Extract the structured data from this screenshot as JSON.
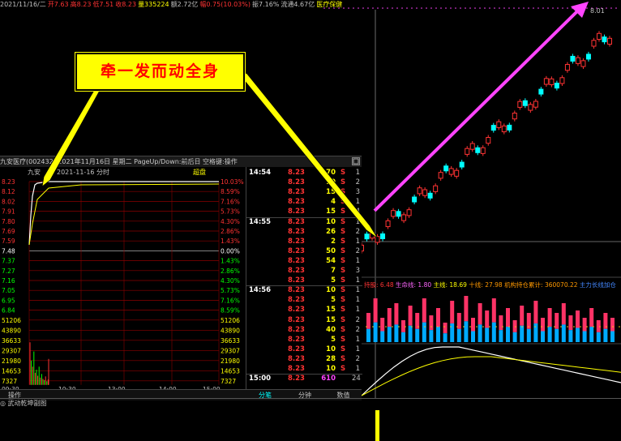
{
  "topbar": [
    {
      "text": "2021/11/16/二",
      "color": "#c0c0c0"
    },
    {
      "text": "开7.63",
      "color": "#ff3333"
    },
    {
      "text": "高8.23",
      "color": "#ff3333"
    },
    {
      "text": "低7.51",
      "color": "#ff3333"
    },
    {
      "text": "收8.23",
      "color": "#ff3333"
    },
    {
      "text": "量335224",
      "color": "#ffff00"
    },
    {
      "text": "额2.72亿",
      "color": "#c0c0c0"
    },
    {
      "text": "幅0.75(10.03%)",
      "color": "#ff3333"
    },
    {
      "text": "振7.16%",
      "color": "#c0c0c0"
    },
    {
      "text": "流通4.67亿",
      "color": "#c0c0c0"
    },
    {
      "text": "医疗保健",
      "color": "#ffff00"
    }
  ],
  "main_chart": {
    "top_price_label": "8.01",
    "indicator_line": [
      {
        "text": "持股: 6.48",
        "color": "#ff3333"
      },
      {
        "text": "生命线: 1.80",
        "color": "#ff66ff"
      },
      {
        "text": "主线: 18.69",
        "color": "#ffff00"
      },
      {
        "text": "十线: 27.98",
        "color": "#ff9900"
      },
      {
        "text": "机构持仓累计: 360070.22",
        "color": "#ff9900"
      },
      {
        "text": "主力长线加仓",
        "color": "#4488ff"
      }
    ],
    "candles": [
      {
        "o": 0.72,
        "c": 0.7,
        "h": 0.735,
        "l": 0.69
      },
      {
        "o": 0.74,
        "c": 0.7,
        "h": 0.75,
        "l": 0.69
      },
      {
        "o": 0.76,
        "c": 0.72,
        "h": 0.77,
        "l": 0.71
      },
      {
        "o": 0.78,
        "c": 0.745,
        "h": 0.79,
        "l": 0.74
      },
      {
        "o": 0.8,
        "c": 0.76,
        "h": 0.81,
        "l": 0.755
      },
      {
        "o": 0.81,
        "c": 0.795,
        "h": 0.82,
        "l": 0.79
      },
      {
        "o": 0.84,
        "c": 0.8,
        "h": 0.85,
        "l": 0.795
      },
      {
        "o": 0.85,
        "c": 0.835,
        "h": 0.86,
        "l": 0.83
      },
      {
        "o": 0.87,
        "c": 0.845,
        "h": 0.875,
        "l": 0.84
      },
      {
        "o": 0.895,
        "c": 0.86,
        "h": 0.9,
        "l": 0.855
      },
      {
        "o": 0.9,
        "c": 0.89,
        "h": 0.91,
        "l": 0.885
      },
      {
        "o": 0.935,
        "c": 0.9,
        "h": 0.94,
        "l": 0.895
      },
      {
        "o": 0.95,
        "c": 0.925,
        "h": 0.955,
        "l": 0.92
      },
      {
        "o": 0.945,
        "c": 0.935,
        "h": 0.95,
        "l": 0.93
      },
      {
        "o": 0.97,
        "c": 0.94,
        "h": 0.975,
        "l": 0.935
      }
    ],
    "volume_bars": [
      0.6,
      0.9,
      0.5,
      0.7,
      0.8,
      0.45,
      0.75,
      0.6,
      0.9,
      0.55,
      0.7,
      0.4,
      0.85,
      0.6,
      0.95,
      0.5,
      0.8,
      0.65,
      0.9,
      0.55,
      0.7,
      0.45,
      0.75,
      0.6,
      0.85,
      0.5,
      0.7,
      0.6,
      0.8,
      0.55,
      0.65,
      0.5,
      0.7,
      0.45,
      0.6,
      0.5
    ]
  },
  "banner": {
    "text": "牵一发而动全身"
  },
  "popup": {
    "title_name": "九安医疗(002432)",
    "title_date": "2021年11月16日 星期二",
    "title_hint": "PageUp/Down:前后日 空格键:操作",
    "stock_short": "九安",
    "chart_date_label": "2021-11-16 分时",
    "chart_mode_label": "超盘",
    "price_labels": [
      "8.23",
      "8.12",
      "8.02",
      "7.91",
      "7.80",
      "7.69",
      "7.59",
      "7.48",
      "7.37",
      "7.27",
      "7.16",
      "7.05",
      "6.95",
      "6.84"
    ],
    "pct_labels": [
      "10.03%",
      "8.59%",
      "7.16%",
      "5.73%",
      "4.30%",
      "2.86%",
      "1.43%",
      "0.00%",
      "1.43%",
      "2.86%",
      "4.30%",
      "5.73%",
      "7.16%",
      "8.59%"
    ],
    "vol_labels": [
      "51206",
      "43890",
      "36633",
      "29307",
      "21980",
      "14653",
      "7327"
    ],
    "time_labels": [
      "09:30",
      "10:30",
      "13:00",
      "14:00",
      "15:00"
    ],
    "ticks": [
      {
        "time": "14:54",
        "price": "8.23",
        "vol": "70",
        "dir": "S",
        "n": "1"
      },
      {
        "time": "",
        "price": "8.23",
        "vol": "10",
        "dir": "S",
        "n": "2"
      },
      {
        "time": "",
        "price": "8.23",
        "vol": "15",
        "dir": "S",
        "n": "3"
      },
      {
        "time": "",
        "price": "8.23",
        "vol": "4",
        "dir": "S",
        "n": "1"
      },
      {
        "time": "",
        "price": "8.23",
        "vol": "15",
        "dir": "S",
        "n": "4"
      },
      {
        "time": "14:55",
        "price": "8.23",
        "vol": "10",
        "dir": "S",
        "n": "1"
      },
      {
        "time": "",
        "price": "8.23",
        "vol": "26",
        "dir": "S",
        "n": "2"
      },
      {
        "time": "",
        "price": "8.23",
        "vol": "2",
        "dir": "S",
        "n": "1"
      },
      {
        "time": "",
        "price": "8.23",
        "vol": "50",
        "dir": "S",
        "n": "2"
      },
      {
        "time": "",
        "price": "8.23",
        "vol": "54",
        "dir": "S",
        "n": "1"
      },
      {
        "time": "",
        "price": "8.23",
        "vol": "7",
        "dir": "S",
        "n": "3"
      },
      {
        "time": "",
        "price": "8.23",
        "vol": "5",
        "dir": "S",
        "n": "1"
      },
      {
        "time": "14:56",
        "price": "8.23",
        "vol": "10",
        "dir": "S",
        "n": "1"
      },
      {
        "time": "",
        "price": "8.23",
        "vol": "5",
        "dir": "S",
        "n": "1"
      },
      {
        "time": "",
        "price": "8.23",
        "vol": "15",
        "dir": "S",
        "n": "1"
      },
      {
        "time": "",
        "price": "8.23",
        "vol": "15",
        "dir": "S",
        "n": "2"
      },
      {
        "time": "",
        "price": "8.23",
        "vol": "40",
        "dir": "S",
        "n": "2"
      },
      {
        "time": "",
        "price": "8.23",
        "vol": "5",
        "dir": "S",
        "n": "1"
      },
      {
        "time": "",
        "price": "8.23",
        "vol": "10",
        "dir": "S",
        "n": "1"
      },
      {
        "time": "",
        "price": "8.23",
        "vol": "28",
        "dir": "S",
        "n": "2"
      },
      {
        "time": "",
        "price": "8.23",
        "vol": "10",
        "dir": "S",
        "n": "1"
      },
      {
        "time": "15:00",
        "price": "8.23",
        "vol": "610",
        "dir": "",
        "n": "24"
      }
    ],
    "tabs": [
      "操作",
      "分笔",
      "分钟",
      "数值"
    ],
    "active_tab": 1
  },
  "bottombar": {
    "label": "武动乾坤副图"
  },
  "colors": {
    "up": "#ff3333",
    "down": "#00ffff",
    "yellow": "#ffff00",
    "magenta": "#ff44ff",
    "grid": "#8b0000",
    "green": "#00ff00"
  }
}
